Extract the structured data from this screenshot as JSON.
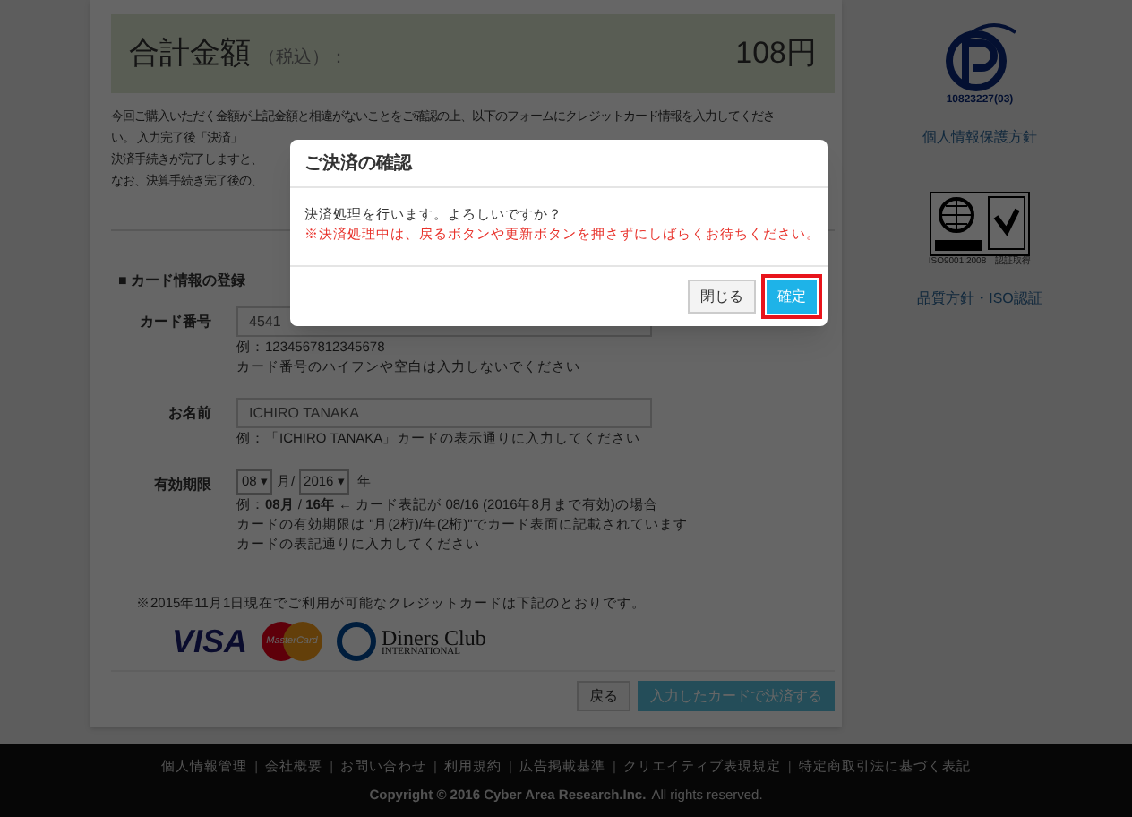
{
  "total": {
    "label": "合計金額",
    "tax_note": "（税込）：",
    "amount": "108円"
  },
  "intro_lines": [
    "今回ご購入いただく金額が上記金額と相違がないことをご確認の上、以下のフォームにクレジットカード情報を入力してくださ",
    "い。 入力完了後「決済」",
    "決済手続きが完了しますと、",
    "なお、決算手続き完了後の、"
  ],
  "section_title": "■ カード情報の登録",
  "form": {
    "card_number": {
      "label": "カード番号",
      "value": "4541",
      "hints": [
        "例：1234567812345678",
        "カード番号のハイフンや空白は入力しないでください"
      ]
    },
    "name": {
      "label": "お名前",
      "value": "ICHIRO TANAKA",
      "hints": [
        "例：「ICHIRO TANAKA」カードの表示通りに入力してください"
      ]
    },
    "expiry": {
      "label": "有効期限",
      "select_arrow": "▾",
      "month": "08",
      "month_unit": "月/",
      "year": "2016",
      "year_unit": "年",
      "hints": [
        "例：**08月** / **16年** ← カード表記が 08/16 (2016年8月まで有効)の場合",
        "カードの有効期限は \"月(2桁)/年(2桁)\"でカード表面に記載されています",
        "カードの表記通りに入力してください"
      ]
    }
  },
  "cards_note": "※2015年11月1日現在でご利用が可能なクレジットカードは下記のとおりです。",
  "card_brands": [
    {
      "kind": "visa",
      "text": "VISA"
    },
    {
      "kind": "mastercard",
      "text": "MasterCard"
    },
    {
      "kind": "diners",
      "text": "Diners Club",
      "subtext": "INTERNATIONAL"
    }
  ],
  "buttons": {
    "back": "戻る",
    "submit": "入力したカードで決済する"
  },
  "sidebar": {
    "privacy_number": "10823227(03)",
    "privacy_link": "個人情報保護方針",
    "iso_caption": "ISO9001:2008　認証取得",
    "iso_link": "品質方針・ISO認証"
  },
  "footer": {
    "separator": "|",
    "links": [
      "個人情報管理",
      "会社概要",
      "お問い合わせ",
      "利用規約",
      "広告掲載基準",
      "クリエイティブ表現規定",
      "特定商取引法に基づく表記"
    ],
    "copyright": "Copyright © 2016 Cyber Area Research.Inc.",
    "rights": "All rights reserved."
  },
  "dialog": {
    "title": "ご決済の確認",
    "message": "決済処理を行います。よろしいですか？",
    "warning": "※決済処理中は、戻るボタンや更新ボタンを押さずにしばらくお待ちください。",
    "buttons": [
      {
        "label": "閉じる",
        "primary": false
      },
      {
        "label": "確定",
        "primary": true
      }
    ]
  }
}
